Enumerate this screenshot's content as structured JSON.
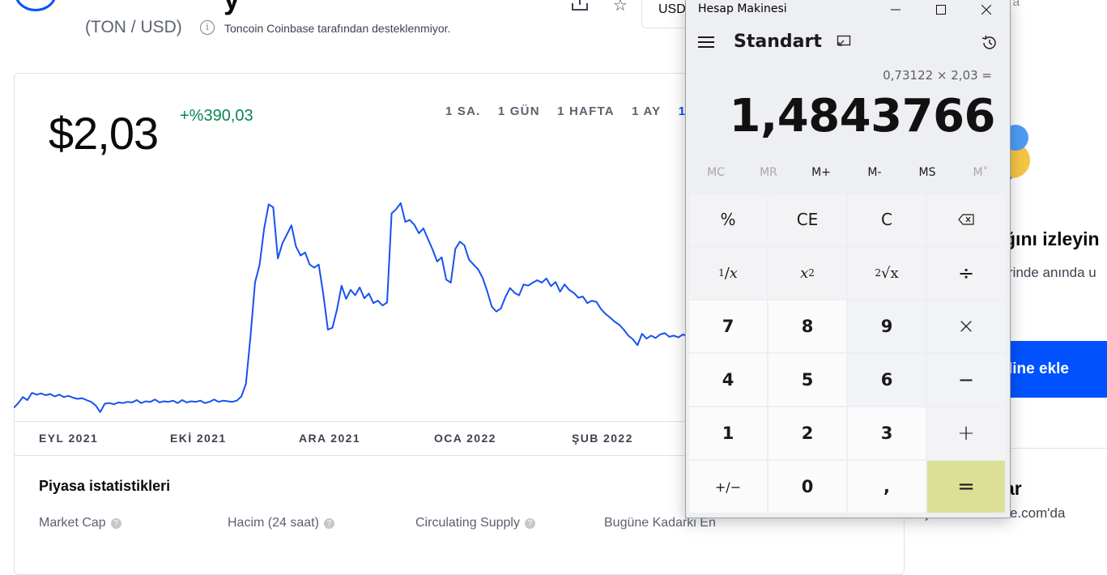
{
  "page": {
    "pair": "(TON / USD)",
    "info_text": "Toncoin Coinbase tarafından desteklenmiyor.",
    "currency_select": "USD",
    "right_top_fragment": "ra",
    "price": "$2,03",
    "change": "+%390,03",
    "ranges": [
      "1 SA.",
      "1 GÜN",
      "1 HAFTA",
      "1 AY",
      "1 YIL"
    ],
    "active_range": "1 YIL",
    "stats_title": "Piyasa istatistikleri",
    "stats_labels": [
      "Market Cap",
      "Hacim (24 saat)",
      "Circulating Supply",
      "Bugüne Kadarki En"
    ],
    "promo_title": "ğını izleyin",
    "promo_sub": "rinde anında u",
    "promo_button": "line ekle",
    "right_title_fragment": "ar",
    "right_bottom_text": "Son 24 saat içinde Coinbase.com'da",
    "colors": {
      "accent": "#0052ff",
      "positive": "#098551",
      "line": "#1652f0"
    }
  },
  "chart_data": {
    "type": "line",
    "x_labels": [
      "EYL 2021",
      "EKİ 2021",
      "ARA 2021",
      "OCA 2022",
      "ŞUB 2022"
    ],
    "series": [
      {
        "values": [
          0.62,
          0.7,
          0.8,
          0.75,
          0.87,
          0.84,
          0.86,
          0.83,
          0.85,
          0.81,
          0.84,
          0.8,
          0.82,
          0.79,
          0.77,
          0.78,
          0.75,
          0.72,
          0.66,
          0.55,
          0.69,
          0.7,
          0.68,
          0.71,
          0.7,
          0.72,
          0.71,
          0.75,
          0.7,
          0.73,
          0.72,
          0.76,
          0.71,
          0.73,
          0.72,
          0.74,
          0.7,
          0.75,
          0.71,
          0.73,
          0.72,
          0.74,
          0.7,
          0.72,
          0.76,
          0.72,
          0.74,
          0.73,
          0.72,
          0.74,
          0.81,
          1.02,
          1.8,
          2.7,
          3.0,
          3.6,
          4.0,
          3.95,
          3.1,
          3.35,
          3.5,
          3.65,
          3.3,
          3.15,
          3.2,
          3.0,
          2.95,
          3.0,
          2.5,
          1.92,
          1.95,
          2.25,
          2.65,
          2.43,
          2.58,
          2.49,
          2.62,
          2.44,
          2.52,
          2.36,
          2.4,
          2.32,
          2.37,
          3.85,
          3.92,
          4.02,
          3.71,
          3.74,
          3.66,
          3.52,
          3.6,
          3.42,
          3.25,
          3.05,
          3.12,
          2.75,
          2.7,
          3.26,
          3.38,
          3.32,
          3.08,
          3.0,
          2.92,
          2.78,
          2.56,
          2.3,
          2.22,
          2.27,
          2.46,
          2.61,
          2.53,
          2.49,
          2.67,
          2.65,
          2.7,
          2.74,
          2.7,
          2.77,
          2.64,
          2.71,
          2.55,
          2.67,
          2.58,
          2.53,
          2.45,
          2.47,
          2.36,
          2.4,
          2.38,
          2.26,
          2.18,
          2.12,
          2.05,
          2.0,
          1.92,
          1.82,
          1.76,
          1.66,
          1.85,
          1.77,
          1.82,
          1.78,
          1.84,
          1.86,
          1.8,
          1.82,
          1.79,
          1.84,
          1.8
        ]
      }
    ]
  },
  "calculator": {
    "app_name": "Hesap Makinesi",
    "mode": "Standart",
    "expression": "0,73122 × 2,03 =",
    "display": "1,4843766",
    "memory_buttons": [
      {
        "label": "MC",
        "enabled": false
      },
      {
        "label": "MR",
        "enabled": false
      },
      {
        "label": "M+",
        "enabled": true
      },
      {
        "label": "M-",
        "enabled": true
      },
      {
        "label": "MS",
        "enabled": true
      },
      {
        "label": "M˅",
        "enabled": false
      }
    ],
    "keys": {
      "percent": "%",
      "ce": "CE",
      "c": "C",
      "backspace": "⌫",
      "reciprocal_num": "1",
      "reciprocal_den": "x",
      "square_base": "x",
      "square_exp": "2",
      "sqrt_index": "2",
      "sqrt_symbol": "√x",
      "divide": "÷",
      "seven": "7",
      "eight": "8",
      "nine": "9",
      "multiply": "×",
      "four": "4",
      "five": "5",
      "six": "6",
      "minus": "−",
      "one": "1",
      "two": "2",
      "three": "3",
      "plus": "+",
      "negate": "+/−",
      "zero": "0",
      "decimal": ",",
      "equals": "="
    }
  }
}
